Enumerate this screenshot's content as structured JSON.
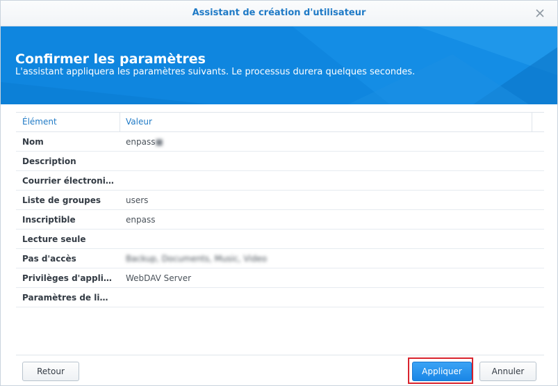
{
  "window": {
    "title": "Assistant de création d'utilisateur",
    "close_icon": "close-icon"
  },
  "banner": {
    "title": "Confirmer les paramètres",
    "subtitle": "L'assistant appliquera les paramètres suivants. Le processus durera quelques secondes.",
    "color": "#0f86df"
  },
  "table": {
    "headers": [
      "Élément",
      "Valeur"
    ],
    "rows": [
      {
        "key": "Nom",
        "value": "enpass",
        "blurred_suffix": "■"
      },
      {
        "key": "Description",
        "value": ""
      },
      {
        "key": "Courrier électroni…",
        "value": ""
      },
      {
        "key": "Liste de groupes",
        "value": "users"
      },
      {
        "key": "Inscriptible",
        "value": "enpass"
      },
      {
        "key": "Lecture seule",
        "value": ""
      },
      {
        "key": "Pas d'accès",
        "value": "Backup, Documents, Music, Video"
      },
      {
        "key": "Privilèges d'appli…",
        "value": "WebDAV Server"
      },
      {
        "key": "Paramètres de li…",
        "value": ""
      }
    ]
  },
  "buttons": {
    "back": "Retour",
    "apply": "Appliquer",
    "cancel": "Annuler"
  },
  "colors": {
    "accent": "#1f7ac6",
    "primary_button": "#1a86e6",
    "highlight_frame": "#d9232d"
  }
}
